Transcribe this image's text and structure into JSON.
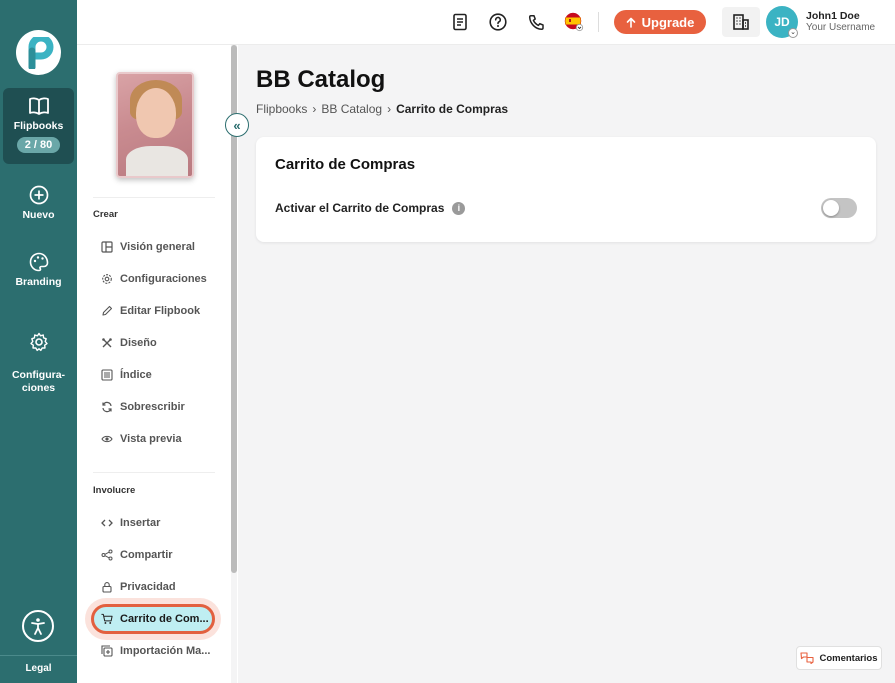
{
  "rail": {
    "items": [
      {
        "label": "Flipbooks",
        "badge": "2 / 80",
        "icon": "open-book-icon",
        "active": true
      },
      {
        "label": "Nuevo",
        "icon": "plus-circle-icon"
      },
      {
        "label": "Branding",
        "icon": "palette-icon"
      },
      {
        "label": "Configura-\nciones",
        "icon": "gear-icon"
      }
    ],
    "legal": "Legal"
  },
  "topbar": {
    "upgrade_label": "Upgrade",
    "user_initials": "JD",
    "user_name": "John1 Doe",
    "user_sub": "Your Username",
    "language_flag": "spain-flag-icon"
  },
  "sidebar": {
    "sections": [
      {
        "title": "Crear",
        "items": [
          {
            "label": "Visión general",
            "icon": "layout-icon"
          },
          {
            "label": "Configuraciones",
            "icon": "gear-icon"
          },
          {
            "label": "Editar Flipbook",
            "icon": "pencil-icon"
          },
          {
            "label": "Diseño",
            "icon": "tools-icon"
          },
          {
            "label": "Índice",
            "icon": "list-icon"
          },
          {
            "label": "Sobrescribir",
            "icon": "refresh-icon"
          },
          {
            "label": "Vista previa",
            "icon": "eye-icon"
          }
        ]
      },
      {
        "title": "Involucre",
        "items": [
          {
            "label": "Insertar",
            "icon": "code-icon"
          },
          {
            "label": "Compartir",
            "icon": "share-icon"
          },
          {
            "label": "Privacidad",
            "icon": "lock-icon"
          },
          {
            "label": "Carrito de Com...",
            "icon": "cart-icon",
            "active": true
          },
          {
            "label": "Importación Ma...",
            "icon": "import-icon"
          }
        ]
      }
    ]
  },
  "main": {
    "title": "BB Catalog",
    "breadcrumbs": [
      "Flipbooks",
      "BB Catalog",
      "Carrito de Compras"
    ],
    "card": {
      "title": "Carrito de Compras",
      "toggle_label": "Activar el Carrito de Compras",
      "toggle_on": false
    }
  },
  "comments_label": "Comentarios",
  "colors": {
    "rail": "#2c6e6f",
    "accent": "#e8613f",
    "active_item_bg": "#bfeef2",
    "avatar": "#3bb3c3"
  }
}
